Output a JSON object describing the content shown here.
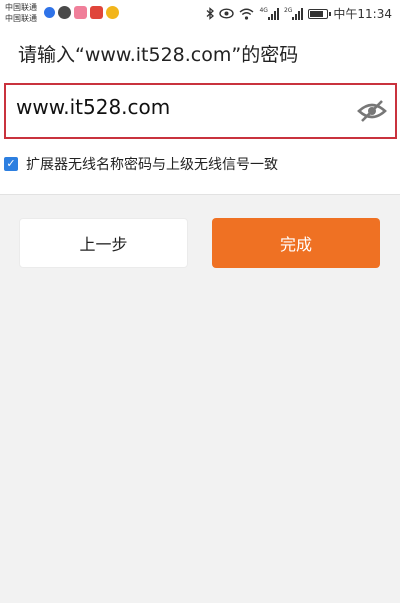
{
  "status_bar": {
    "carrier_1": "中国联通",
    "carrier_2": "中国联通",
    "signal_label_1": "4G",
    "signal_label_2": "2G",
    "time": "中午11:34",
    "notification_icons": [
      "baidu-icon",
      "wechat-icon",
      "app-icon",
      "app-icon",
      "weibo-icon"
    ],
    "right_icons": [
      "bluetooth-icon",
      "eye-icon",
      "wifi-icon",
      "signal-icon",
      "signal-icon",
      "battery-icon"
    ]
  },
  "dialog": {
    "title": "请输入“www.it528.com”的密码",
    "password_value": "www.it528.com",
    "toggle_visibility_icon": "eye-off-icon",
    "checkbox_checked": true,
    "checkbox_label": "扩展器无线名称密码与上级无线信号一致"
  },
  "buttons": {
    "prev_label": "上一步",
    "done_label": "完成"
  },
  "colors": {
    "accent_orange": "#ef7123",
    "error_red_border": "#c9323d",
    "checkbox_blue": "#2d7fe0"
  }
}
